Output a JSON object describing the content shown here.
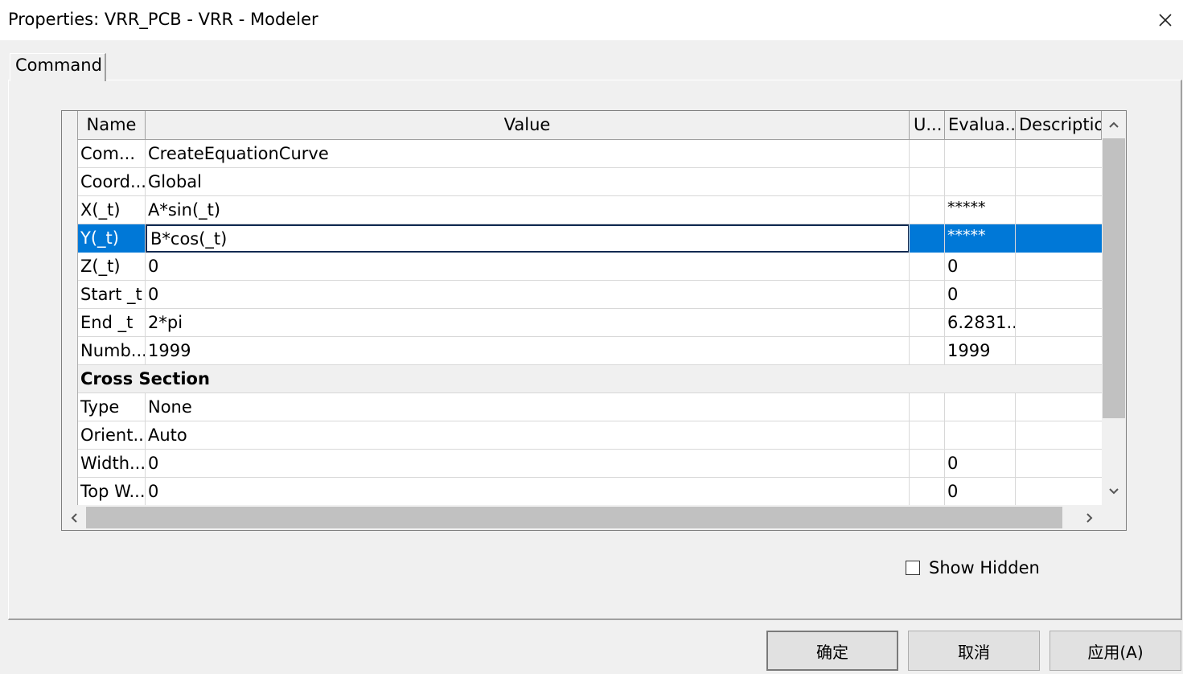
{
  "window": {
    "title": "Properties: VRR_PCB - VRR - Modeler"
  },
  "tabs": [
    {
      "label": "Command"
    }
  ],
  "grid": {
    "headers": {
      "name": "Name",
      "value": "Value",
      "unit": "U...",
      "evaluated": "Evalua...",
      "description": "Descriptio"
    },
    "rows": [
      {
        "name": "Com...",
        "value": "CreateEquationCurve",
        "unit": "",
        "evaluated": "",
        "description": ""
      },
      {
        "name": "Coord...",
        "value": "Global",
        "unit": "",
        "evaluated": "",
        "description": ""
      },
      {
        "name": "X(_t)",
        "value": "A*sin(_t)",
        "unit": "",
        "evaluated": "*****",
        "description": ""
      },
      {
        "name": "Y(_t)",
        "value": "B*cos(_t)",
        "unit": "",
        "evaluated": "*****",
        "description": ""
      },
      {
        "name": "Z(_t)",
        "value": "0",
        "unit": "",
        "evaluated": "0",
        "description": ""
      },
      {
        "name": "Start _t",
        "value": "0",
        "unit": "",
        "evaluated": "0",
        "description": ""
      },
      {
        "name": "End _t",
        "value": "2*pi",
        "unit": "",
        "evaluated": "6.2831...",
        "description": ""
      },
      {
        "name": "Numb...",
        "value": "1999",
        "unit": "",
        "evaluated": "1999",
        "description": ""
      }
    ],
    "group": {
      "label": "Cross Section"
    },
    "group_rows": [
      {
        "name": "Type",
        "value": "None",
        "unit": "",
        "evaluated": "",
        "description": ""
      },
      {
        "name": "Orient...",
        "value": "Auto",
        "unit": "",
        "evaluated": "",
        "description": ""
      },
      {
        "name": "Width...",
        "value": "0",
        "unit": "",
        "evaluated": "0",
        "description": ""
      },
      {
        "name": "Top W...",
        "value": "0",
        "unit": "",
        "evaluated": "0",
        "description": ""
      }
    ]
  },
  "show_hidden": {
    "label": "Show Hidden",
    "checked": false
  },
  "buttons": {
    "ok": "确定",
    "cancel": "取消",
    "apply": "应用(A)"
  },
  "colors": {
    "selection": "#0078d7",
    "dialog_bg": "#f0f0f0"
  },
  "icons": {
    "close": "close-icon",
    "scroll_up": "chevron-up-icon",
    "scroll_down": "chevron-down-icon",
    "scroll_left": "chevron-left-icon",
    "scroll_right": "chevron-right-icon"
  }
}
